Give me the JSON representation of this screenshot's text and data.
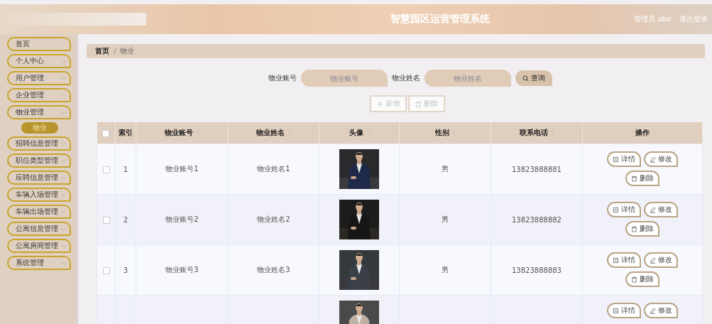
{
  "header": {
    "title": "智慧园区运营管理系统",
    "user": "管理员 abo",
    "logout": "退出登录"
  },
  "sidebar": {
    "items": [
      {
        "label": "首页",
        "kind": "link"
      },
      {
        "label": "个人中心",
        "kind": "menu"
      },
      {
        "label": "用户管理",
        "kind": "menu"
      },
      {
        "label": "企业管理",
        "kind": "menu"
      },
      {
        "label": "物业管理",
        "kind": "menu",
        "children": [
          {
            "label": "物业",
            "selected": true
          }
        ]
      },
      {
        "label": "招聘信息管理",
        "kind": "menu"
      },
      {
        "label": "职位类型管理",
        "kind": "menu"
      },
      {
        "label": "应聘信息管理",
        "kind": "menu"
      },
      {
        "label": "车辆入场管理",
        "kind": "menu"
      },
      {
        "label": "车辆出场管理",
        "kind": "menu"
      },
      {
        "label": "公寓信息管理",
        "kind": "menu"
      },
      {
        "label": "公寓房间管理",
        "kind": "menu"
      },
      {
        "label": "系统管理",
        "kind": "menu"
      }
    ]
  },
  "breadcrumb": [
    "首页",
    "物业"
  ],
  "breadcrumb_separator": "/",
  "search": {
    "fields": [
      {
        "label": "物业账号",
        "placeholder": "物业账号"
      },
      {
        "label": "物业姓名",
        "placeholder": "物业姓名"
      }
    ],
    "button": "查询"
  },
  "toolbar": [
    {
      "label": "新增",
      "kind": "add",
      "disabled": true
    },
    {
      "label": "删除",
      "kind": "delete",
      "disabled": true
    }
  ],
  "table": {
    "header_checked": false,
    "columns": [
      {
        "label": "索引",
        "sortable": false
      },
      {
        "label": "物业账号",
        "sortable": true
      },
      {
        "label": "物业姓名",
        "sortable": true
      },
      {
        "label": "头像",
        "sortable": true
      },
      {
        "label": "性别",
        "sortable": true
      },
      {
        "label": "联系电话",
        "sortable": true
      },
      {
        "label": "操作",
        "sortable": false
      }
    ],
    "rows": [
      {
        "checked": false,
        "index": "1",
        "account": "物业账号1",
        "name": "物业姓名1",
        "photo": {
          "kind": "picture"
        },
        "gender": "男",
        "phone": "13823888881",
        "actions": [
          {
            "label": "详情",
            "kind": "detail"
          },
          {
            "label": "修改",
            "kind": "edit"
          },
          {
            "label": "删除",
            "kind": "delete"
          }
        ]
      },
      {
        "checked": false,
        "index": "2",
        "account": "物业账号2",
        "name": "物业姓名2",
        "photo": {
          "kind": "picture"
        },
        "gender": "男",
        "phone": "13823888882",
        "actions": [
          {
            "label": "详情",
            "kind": "detail"
          },
          {
            "label": "修改",
            "kind": "edit"
          },
          {
            "label": "删除",
            "kind": "delete"
          }
        ]
      },
      {
        "checked": false,
        "index": "3",
        "account": "物业账号3",
        "name": "物业姓名3",
        "photo": {
          "kind": "picture"
        },
        "gender": "男",
        "phone": "13823888883",
        "actions": [
          {
            "label": "详情",
            "kind": "detail"
          },
          {
            "label": "修改",
            "kind": "edit"
          },
          {
            "label": "删除",
            "kind": "delete"
          }
        ]
      },
      {
        "photo": {
          "kind": "picture"
        },
        "actions": [
          {
            "label": "详情",
            "kind": "detail"
          },
          {
            "label": "修改",
            "kind": "edit"
          }
        ]
      }
    ]
  }
}
